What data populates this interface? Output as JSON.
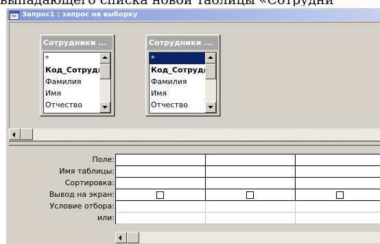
{
  "doc_text": "выпадающего списка новой таблицы «Сотрудни",
  "window": {
    "title": "Запрос1 : запрос на выборку",
    "icon": "query-window-icon"
  },
  "field_lists": [
    {
      "title": "Сотрудники ...",
      "fields": [
        "*",
        "Код_Сотрудн",
        "Фамилия",
        "Имя",
        "Отчество"
      ],
      "selected_index": -1
    },
    {
      "title": "Сотрудники ...",
      "fields": [
        "*",
        "Код_Сотрудн",
        "Фамилия",
        "Имя",
        "Отчество"
      ],
      "selected_index": 0
    }
  ],
  "grid": {
    "row_labels": [
      "Поле:",
      "Имя таблицы:",
      "Сортировка:",
      "Вывод на экран:",
      "Условие отбора:",
      "или:"
    ]
  },
  "icons": {
    "scroll_up": "scroll-up-arrow-icon",
    "scroll_down": "scroll-down-arrow-icon",
    "scroll_left": "scroll-left-arrow-icon"
  },
  "colors": {
    "title_gradient_start": "#7a96df",
    "selection": "#0a246a",
    "field_list_title": "#a6a6a6",
    "face": "#d4d0c8"
  }
}
